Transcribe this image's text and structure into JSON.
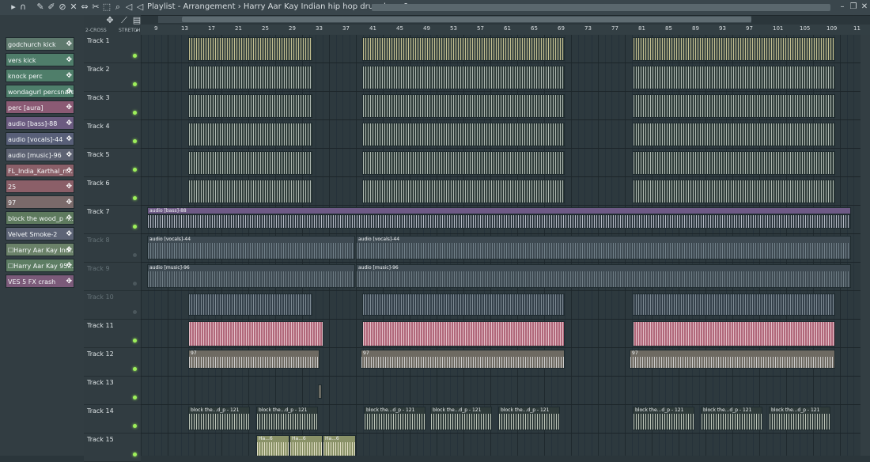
{
  "window": {
    "title": "Playlist - Arrangement",
    "breadcrumb_sep": "›",
    "pattern": "Harry Aar Kay Indian hip hop drum loop 6",
    "pattern_arrow": "›",
    "minimize": "–",
    "restore": "❐",
    "close": "✕"
  },
  "toolbar": {
    "icons": [
      "play-arrow-icon",
      "magnet-icon",
      "pencil-icon",
      "paint-brush-icon",
      "delete-icon",
      "mute-icon",
      "slip-icon",
      "slice-icon",
      "select-icon",
      "zoom-icon",
      "playback-icon"
    ],
    "glyphs": [
      "▸",
      "∩",
      "✎",
      "✐",
      "⊘",
      "✕",
      "⇔",
      "✂",
      "⬚",
      "⌕",
      "◁"
    ]
  },
  "sidebar": {
    "tool_glyphs": [
      "Ш",
      "✥",
      "⟋"
    ],
    "clips": [
      {
        "label": "godchurch kick",
        "color": "#5f7a6e"
      },
      {
        "label": "vers kick",
        "color": "#4f7d6a"
      },
      {
        "label": "knock perc",
        "color": "#4f7e6a"
      },
      {
        "label": "wondagurl percsnare",
        "color": "#4e7e6b"
      },
      {
        "label": "perc [aura]",
        "color": "#8b5a74"
      },
      {
        "label": "audio [bass]-88",
        "color": "#6b5b80"
      },
      {
        "label": "audio [vocals]-44",
        "color": "#585f78"
      },
      {
        "label": "audio [music]-96",
        "color": "#5d6272"
      },
      {
        "label": "FL_India_Karthal_n...",
        "color": "#8a5f68"
      },
      {
        "label": "25",
        "color": "#8b5f68"
      },
      {
        "label": "97",
        "color": "#7a6a6a"
      },
      {
        "label": "block the wood_p -...",
        "color": "#5e7a5e"
      },
      {
        "label": "Velvet Smoke-2",
        "color": "#5d6476"
      },
      {
        "label": "☐Harry Aar Kay Indi...",
        "color": "#6b8269"
      },
      {
        "label": "☐Harry Aar Kay 95...",
        "color": "#5d7d63"
      },
      {
        "label": "VES 5 FX crash",
        "color": "#7b5a79"
      }
    ],
    "clip_icon": "✥"
  },
  "header": {
    "snap_label": "2-CROSS",
    "stretch_label": "STRETCH",
    "arrow": "▸"
  },
  "ruler": {
    "numbers": [
      "9",
      "13",
      "17",
      "21",
      "25",
      "29",
      "33",
      "37",
      "41",
      "45",
      "49",
      "53",
      "57",
      "61",
      "65",
      "69",
      "73",
      "77",
      "81",
      "85",
      "89",
      "93",
      "97",
      "101",
      "105",
      "109",
      "11"
    ]
  },
  "tracks": [
    {
      "label": "Track 1",
      "muted": false
    },
    {
      "label": "Track 2",
      "muted": false
    },
    {
      "label": "Track 3",
      "muted": false
    },
    {
      "label": "Track 4",
      "muted": false
    },
    {
      "label": "Track 5",
      "muted": false
    },
    {
      "label": "Track 6",
      "muted": false
    },
    {
      "label": "Track 7",
      "muted": false
    },
    {
      "label": "Track 8",
      "muted": true
    },
    {
      "label": "Track 9",
      "muted": true
    },
    {
      "label": "Track 10",
      "muted": true
    },
    {
      "label": "Track 11",
      "muted": false
    },
    {
      "label": "Track 12",
      "muted": false
    },
    {
      "label": "Track 13",
      "muted": false
    },
    {
      "label": "Track 14",
      "muted": false
    },
    {
      "label": "Track 15",
      "muted": false
    }
  ],
  "playlist_clips": {
    "bass": "audio [bass]-88",
    "vocals": "audio [vocals]-44",
    "music": "audio [music]-96",
    "num97": "97",
    "block": "block the...d_p - 121",
    "harry": "Ha...6",
    "colors": {
      "drum": "#7c8a62",
      "drum2": "#566f63",
      "bass": "#6e5a86",
      "vocals": "#3e4a52",
      "perc11": "#b0677a",
      "clip12": "#6e6a62",
      "block": "#6c8a66",
      "harry": "#8a9268"
    }
  }
}
